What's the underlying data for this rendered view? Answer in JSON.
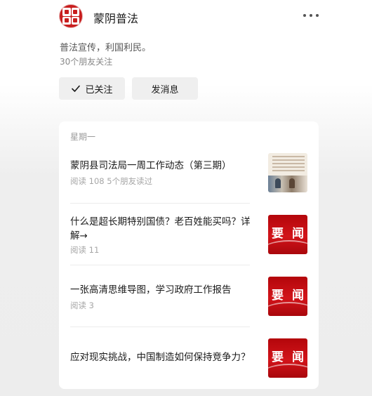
{
  "account": {
    "name": "蒙阴普法",
    "slogan": "普法宣传，利国利民。",
    "followers": "30个朋友关注"
  },
  "actions": {
    "follow_label": "已关注",
    "message_label": "发消息"
  },
  "feed": {
    "day": "星期一",
    "articles": [
      {
        "title": "蒙阴县司法局一周工作动态（第三期）",
        "meta": "阅读 108   5个朋友读过",
        "thumb": "photo"
      },
      {
        "title": "什么是超长期特别国债？老百姓能买吗？详解→",
        "meta": "阅读 11",
        "thumb": "news",
        "thumb_text": [
          "要",
          "闻"
        ]
      },
      {
        "title": "一张高清思维导图，学习政府工作报告",
        "meta": "阅读 3",
        "thumb": "news",
        "thumb_text": [
          "要",
          "闻"
        ]
      },
      {
        "title": "应对现实挑战，中国制造如何保持竞争力？",
        "meta": "",
        "thumb": "news",
        "thumb_text": [
          "要",
          "闻"
        ]
      }
    ]
  },
  "icons": {
    "more": "more-dots-icon",
    "check": "check-icon"
  },
  "colors": {
    "accent_red": "#c81e1e",
    "button_bg": "#efefef"
  }
}
